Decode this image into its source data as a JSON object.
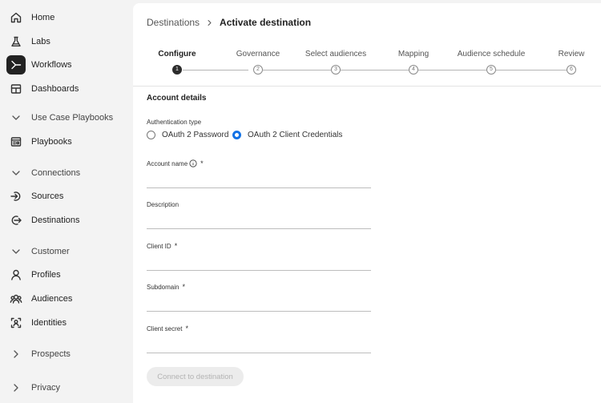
{
  "sidebar": {
    "items": [
      {
        "label": "Home",
        "icon": "home-icon"
      },
      {
        "label": "Labs",
        "icon": "flask-icon"
      },
      {
        "label": "Workflows",
        "icon": "workflow-icon",
        "active": true
      },
      {
        "label": "Dashboards",
        "icon": "dashboard-icon"
      },
      {
        "label": "Use Case Playbooks",
        "icon": "chevron-down-icon",
        "section": true
      },
      {
        "label": "Playbooks",
        "icon": "playbook-icon"
      },
      {
        "label": "Connections",
        "icon": "chevron-down-icon",
        "section": true
      },
      {
        "label": "Sources",
        "icon": "sources-icon"
      },
      {
        "label": "Destinations",
        "icon": "destinations-icon"
      },
      {
        "label": "Customer",
        "icon": "chevron-down-icon",
        "section": true
      },
      {
        "label": "Profiles",
        "icon": "person-icon"
      },
      {
        "label": "Audiences",
        "icon": "audiences-icon"
      },
      {
        "label": "Identities",
        "icon": "identity-icon"
      },
      {
        "label": "Prospects",
        "icon": "chevron-right-icon",
        "section": true
      },
      {
        "label": "Privacy",
        "icon": "chevron-right-icon",
        "section": true
      }
    ]
  },
  "breadcrumb": {
    "parent": "Destinations",
    "current": "Activate destination"
  },
  "stepper": {
    "steps": [
      {
        "label": "Configure",
        "number": "1",
        "current": true
      },
      {
        "label": "Governance",
        "number": "2"
      },
      {
        "label": "Select audiences",
        "number": "3"
      },
      {
        "label": "Mapping",
        "number": "4"
      },
      {
        "label": "Audience schedule",
        "number": "5"
      },
      {
        "label": "Review",
        "number": "6"
      }
    ]
  },
  "form": {
    "section_title": "Account details",
    "auth_type_label": "Authentication type",
    "auth_options": [
      {
        "label": "OAuth 2 Password",
        "selected": false
      },
      {
        "label": "OAuth 2 Client Credentials",
        "selected": true
      }
    ],
    "fields": {
      "account_name": {
        "label": "Account name",
        "required": "*",
        "value": ""
      },
      "description": {
        "label": "Description",
        "value": ""
      },
      "client_id": {
        "label": "Client ID",
        "required": "*",
        "value": ""
      },
      "subdomain": {
        "label": "Subdomain",
        "required": "*",
        "value": ""
      },
      "client_secret": {
        "label": "Client secret",
        "required": "*",
        "value": ""
      }
    },
    "connect_button": "Connect to destination"
  },
  "colors": {
    "accent": "#1473e6",
    "sidebar_bg": "#f3f3f3",
    "active_nav_bg": "#222222"
  }
}
